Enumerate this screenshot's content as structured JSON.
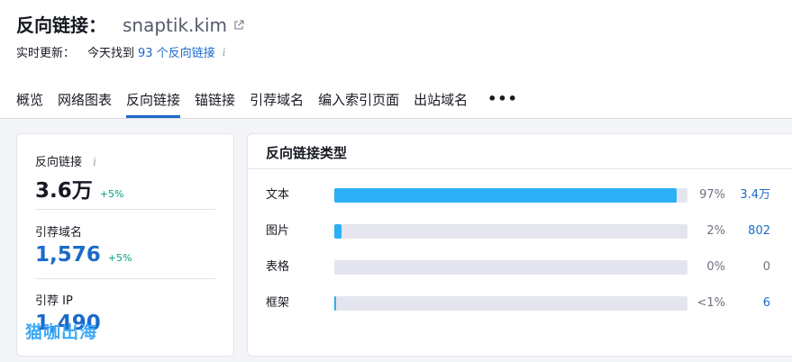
{
  "header": {
    "title": "反向链接：",
    "domain": "snaptik.kim",
    "update_label": "实时更新：",
    "update_text": "今天找到",
    "update_link": "93 个反向链接"
  },
  "tabs": [
    {
      "label": "概览",
      "active": false
    },
    {
      "label": "网络图表",
      "active": false
    },
    {
      "label": "反向链接",
      "active": true
    },
    {
      "label": "锚链接",
      "active": false
    },
    {
      "label": "引荐域名",
      "active": false
    },
    {
      "label": "编入索引页面",
      "active": false
    },
    {
      "label": "出站域名",
      "active": false
    }
  ],
  "tabs_more": "•••",
  "metrics": {
    "backlinks": {
      "label": "反向链接",
      "value": "3.6万",
      "delta": "+5%"
    },
    "ref_domains": {
      "label": "引荐域名",
      "value": "1,576",
      "delta": "+5%"
    },
    "ref_ip": {
      "label": "引荐 IP",
      "value": "1,490"
    }
  },
  "watermark": "猫咖出海",
  "types_card": {
    "title": "反向链接类型",
    "rows": [
      {
        "label": "文本",
        "pct_text": "97%",
        "fill": 0.97,
        "count": "3.4万",
        "count_is_link": true
      },
      {
        "label": "图片",
        "pct_text": "2%",
        "fill": 0.02,
        "count": "802",
        "count_is_link": true
      },
      {
        "label": "表格",
        "pct_text": "0%",
        "fill": 0.0,
        "count": "0",
        "count_is_link": false
      },
      {
        "label": "框架",
        "pct_text": "<1%",
        "fill": 0.005,
        "count": "6",
        "count_is_link": true
      }
    ]
  },
  "colors": {
    "accent_blue": "#1b6ac9",
    "bar_blue": "#2bb0f5",
    "delta_green": "#009f81"
  }
}
